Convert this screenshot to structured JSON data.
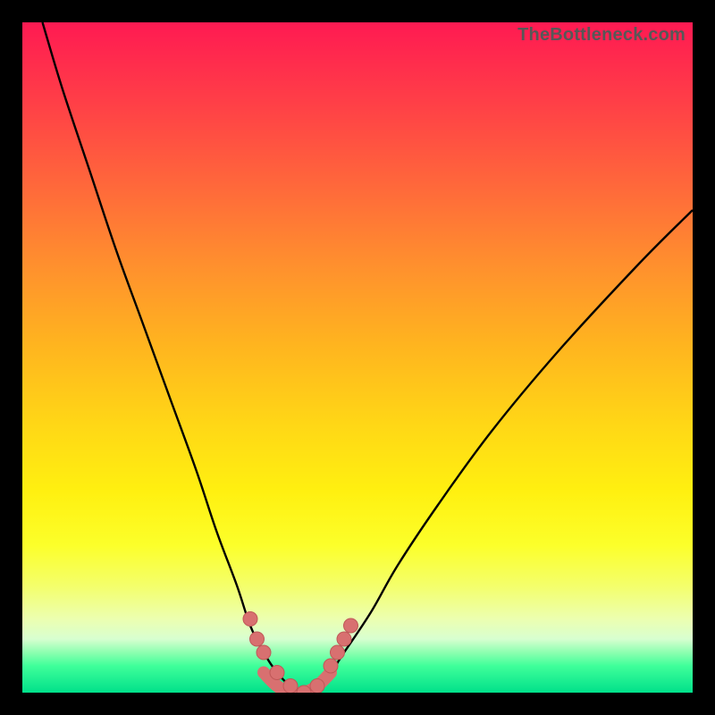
{
  "attribution": "TheBottleneck.com",
  "chart_data": {
    "type": "line",
    "title": "",
    "xlabel": "",
    "ylabel": "",
    "xlim": [
      0,
      100
    ],
    "ylim": [
      0,
      100
    ],
    "grid": false,
    "legend": false,
    "series": [
      {
        "name": "left-curve",
        "x": [
          3,
          6,
          10,
          14,
          18,
          22,
          26,
          29,
          32,
          34,
          36,
          38,
          40,
          42
        ],
        "y": [
          100,
          90,
          78,
          66,
          55,
          44,
          33,
          24,
          16,
          10,
          6,
          3,
          1,
          0
        ]
      },
      {
        "name": "right-curve",
        "x": [
          42,
          44,
          46,
          48,
          52,
          56,
          62,
          70,
          80,
          92,
          100
        ],
        "y": [
          0,
          1,
          3,
          6,
          12,
          19,
          28,
          39,
          51,
          64,
          72
        ]
      },
      {
        "name": "bottom-marker-dots",
        "x": [
          34,
          35,
          36,
          38,
          40,
          42,
          44,
          46,
          47,
          48,
          49
        ],
        "y": [
          11,
          8,
          6,
          3,
          1,
          0,
          1,
          4,
          6,
          8,
          10
        ]
      },
      {
        "name": "bottom-marker-worm",
        "x": [
          36,
          38,
          40,
          42,
          44,
          46
        ],
        "y": [
          3,
          1,
          0,
          0,
          1,
          3
        ]
      }
    ],
    "colors": {
      "curve": "#000000",
      "marker_fill": "#d87070",
      "marker_stroke": "#c05858"
    },
    "gradient_colors": {
      "top": "#ff1a52",
      "mid_high": "#ffb41f",
      "mid_low": "#fff010",
      "bottom": "#00e18a"
    }
  }
}
